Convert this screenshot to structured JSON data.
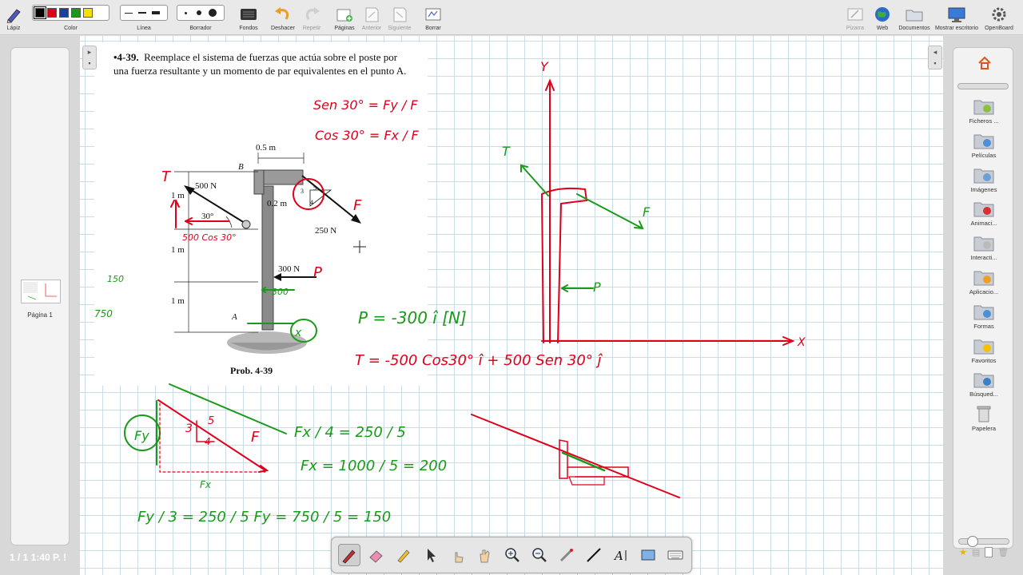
{
  "toolbar": {
    "pen_label": "Lápiz",
    "color_label": "Color",
    "line_label": "Línea",
    "eraser_label": "Borrador",
    "backgrounds_label": "Fondos",
    "undo_label": "Deshacer",
    "redo_label": "Repetir",
    "pages_label": "Páginas",
    "previous_label": "Anterior",
    "next_label": "Siguiente",
    "clear_label": "Borrar",
    "board_label": "Pizarra",
    "web_label": "Web",
    "documents_label": "Documentos",
    "desktop_label": "Mostrar escritorio",
    "app_label": "OpenBoard",
    "colors": [
      "#000000",
      "#e0001a",
      "#1a3fa0",
      "#1a9a1a",
      "#f5e000"
    ]
  },
  "left_panel": {
    "thumbnail_label": "Página 1",
    "page_counter": "1 / 1 1:40 P. !"
  },
  "problem": {
    "number": "•4-39.",
    "statement": "Reemplace el sistema de fuerzas que actúa sobre el poste por una fuerza resultante y un momento de par equivalentes en el punto A.",
    "caption": "Prob. 4-39",
    "labels": {
      "half_m": "0.5 m",
      "point_b": "B",
      "force_500": "500 N",
      "one_m_top": "1 m",
      "angle_30": "30°",
      "point_02": "0.2 m",
      "force_250": "250 N",
      "one_m_mid": "1 m",
      "force_300": "300 N",
      "one_m_bot": "1 m",
      "point_a": "A",
      "tri_3": "3",
      "tri_4": "4",
      "tri_5": "5"
    }
  },
  "annotations": {
    "sen30": "Sen 30° = Fy / F",
    "cos30": "Cos 30° = Fx / F",
    "vec_T": "T",
    "vec_F": "F",
    "vec_P": "P",
    "T_comp": "500 Cos 30°",
    "P_eq": "P = -300 î  [N]",
    "T_eq": "T = -500 Cos30° î + 500 Sen 30° ĵ",
    "p300": "300",
    "left_150": "150",
    "left_750": "750",
    "fx_eq1": "Fx / 4 = 250 / 5",
    "fx_eq2": "Fx = 1000 / 5 = 200",
    "fy_eq": "Fy / 3 = 250 / 5    Fy = 750 / 5 = 150",
    "fy_circle": "Fy",
    "fx_label": "Fx",
    "tri_F": "F",
    "tri_3": "3",
    "tri_4": "4",
    "tri_5": "5",
    "axis_y": "Y",
    "axis_x": "X",
    "x_label": "x"
  },
  "library": {
    "items": [
      {
        "label": "Ficheros ...",
        "icon": "audio-folder-icon"
      },
      {
        "label": "Películas",
        "icon": "film-folder-icon"
      },
      {
        "label": "Imágenes",
        "icon": "image-folder-icon"
      },
      {
        "label": "Animaci...",
        "icon": "animation-folder-icon"
      },
      {
        "label": "Interacti...",
        "icon": "interactive-folder-icon"
      },
      {
        "label": "Aplicacio...",
        "icon": "apps-folder-icon"
      },
      {
        "label": "Formas",
        "icon": "shapes-folder-icon"
      },
      {
        "label": "Favoritos",
        "icon": "favorites-folder-icon"
      },
      {
        "label": "Búsqued...",
        "icon": "search-folder-icon"
      },
      {
        "label": "Papelera",
        "icon": "trash-icon"
      }
    ]
  },
  "palette": {
    "tools": [
      "pen-tool",
      "eraser-tool",
      "marker-tool",
      "selector-tool",
      "interactor-tool",
      "hand-tool",
      "zoom-in-tool",
      "zoom-out-tool",
      "laser-tool",
      "line-tool",
      "text-tool",
      "capture-tool",
      "keyboard-tool"
    ]
  }
}
